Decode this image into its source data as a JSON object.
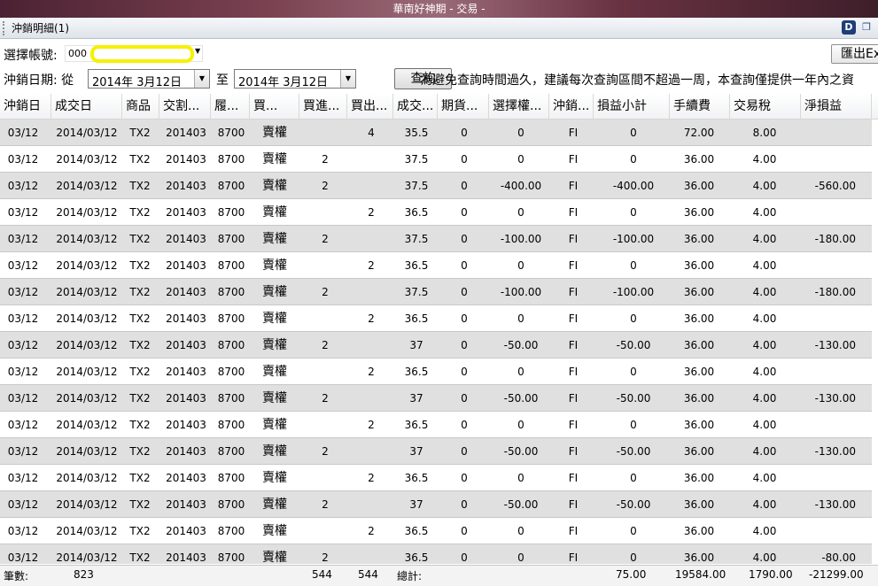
{
  "window": {
    "title": "華南好神期 - 交易 -"
  },
  "toolbar": {
    "title": "沖銷明細(1)"
  },
  "account": {
    "label": "選擇帳號:",
    "value": "000"
  },
  "export": {
    "label": "匯出Ex"
  },
  "date": {
    "label": "沖銷日期: 從",
    "from": "2014年  3月12日",
    "to_label": "至",
    "to": "2014年  3月12日",
    "query_label": "查詢",
    "notice": "為避免查詢時間過久，建議每次查詢區間不超過一周，本查詢僅提供一年內之資"
  },
  "grid": {
    "columns": [
      "沖銷日",
      "成交日",
      "商品",
      "交割...",
      "履...",
      "買...",
      "買進...",
      "買出...",
      "成交...",
      "期貨...",
      "選擇權...",
      "沖銷...",
      "損益小計",
      "手續費",
      "交易稅",
      "淨損益"
    ],
    "rows": [
      [
        "03/12",
        "2014/03/12",
        "TX2",
        "201403",
        "8700",
        "賣權",
        "",
        "4",
        "35.5",
        "0",
        "0",
        "FI",
        "0",
        "72.00",
        "8.00",
        ""
      ],
      [
        "03/12",
        "2014/03/12",
        "TX2",
        "201403",
        "8700",
        "賣權",
        "2",
        "",
        "37.5",
        "0",
        "0",
        "FI",
        "0",
        "36.00",
        "4.00",
        ""
      ],
      [
        "03/12",
        "2014/03/12",
        "TX2",
        "201403",
        "8700",
        "賣權",
        "2",
        "",
        "37.5",
        "0",
        "-400.00",
        "FI",
        "-400.00",
        "36.00",
        "4.00",
        "-560.00"
      ],
      [
        "03/12",
        "2014/03/12",
        "TX2",
        "201403",
        "8700",
        "賣權",
        "",
        "2",
        "36.5",
        "0",
        "0",
        "FI",
        "0",
        "36.00",
        "4.00",
        ""
      ],
      [
        "03/12",
        "2014/03/12",
        "TX2",
        "201403",
        "8700",
        "賣權",
        "2",
        "",
        "37.5",
        "0",
        "-100.00",
        "FI",
        "-100.00",
        "36.00",
        "4.00",
        "-180.00"
      ],
      [
        "03/12",
        "2014/03/12",
        "TX2",
        "201403",
        "8700",
        "賣權",
        "",
        "2",
        "36.5",
        "0",
        "0",
        "FI",
        "0",
        "36.00",
        "4.00",
        ""
      ],
      [
        "03/12",
        "2014/03/12",
        "TX2",
        "201403",
        "8700",
        "賣權",
        "2",
        "",
        "37.5",
        "0",
        "-100.00",
        "FI",
        "-100.00",
        "36.00",
        "4.00",
        "-180.00"
      ],
      [
        "03/12",
        "2014/03/12",
        "TX2",
        "201403",
        "8700",
        "賣權",
        "",
        "2",
        "36.5",
        "0",
        "0",
        "FI",
        "0",
        "36.00",
        "4.00",
        ""
      ],
      [
        "03/12",
        "2014/03/12",
        "TX2",
        "201403",
        "8700",
        "賣權",
        "2",
        "",
        "37",
        "0",
        "-50.00",
        "FI",
        "-50.00",
        "36.00",
        "4.00",
        "-130.00"
      ],
      [
        "03/12",
        "2014/03/12",
        "TX2",
        "201403",
        "8700",
        "賣權",
        "",
        "2",
        "36.5",
        "0",
        "0",
        "FI",
        "0",
        "36.00",
        "4.00",
        ""
      ],
      [
        "03/12",
        "2014/03/12",
        "TX2",
        "201403",
        "8700",
        "賣權",
        "2",
        "",
        "37",
        "0",
        "-50.00",
        "FI",
        "-50.00",
        "36.00",
        "4.00",
        "-130.00"
      ],
      [
        "03/12",
        "2014/03/12",
        "TX2",
        "201403",
        "8700",
        "賣權",
        "",
        "2",
        "36.5",
        "0",
        "0",
        "FI",
        "0",
        "36.00",
        "4.00",
        ""
      ],
      [
        "03/12",
        "2014/03/12",
        "TX2",
        "201403",
        "8700",
        "賣權",
        "2",
        "",
        "37",
        "0",
        "-50.00",
        "FI",
        "-50.00",
        "36.00",
        "4.00",
        "-130.00"
      ],
      [
        "03/12",
        "2014/03/12",
        "TX2",
        "201403",
        "8700",
        "賣權",
        "",
        "2",
        "36.5",
        "0",
        "0",
        "FI",
        "0",
        "36.00",
        "4.00",
        ""
      ],
      [
        "03/12",
        "2014/03/12",
        "TX2",
        "201403",
        "8700",
        "賣權",
        "2",
        "",
        "37",
        "0",
        "-50.00",
        "FI",
        "-50.00",
        "36.00",
        "4.00",
        "-130.00"
      ],
      [
        "03/12",
        "2014/03/12",
        "TX2",
        "201403",
        "8700",
        "賣權",
        "",
        "2",
        "36.5",
        "0",
        "0",
        "FI",
        "0",
        "36.00",
        "4.00",
        ""
      ],
      [
        "03/12",
        "2014/03/12",
        "TX2",
        "201403",
        "8700",
        "賣權",
        "2",
        "",
        "36.5",
        "0",
        "0",
        "FI",
        "0",
        "36.00",
        "4.00",
        "-80.00"
      ]
    ]
  },
  "footer": {
    "count_label": "筆數:",
    "count": "823",
    "buy_total": "544",
    "sell_total": "544",
    "total_label": "總計:",
    "pl_total": "75.00",
    "fee_total": "19584.00",
    "tax_total": "1790.00",
    "net_total": "-21299.00"
  }
}
